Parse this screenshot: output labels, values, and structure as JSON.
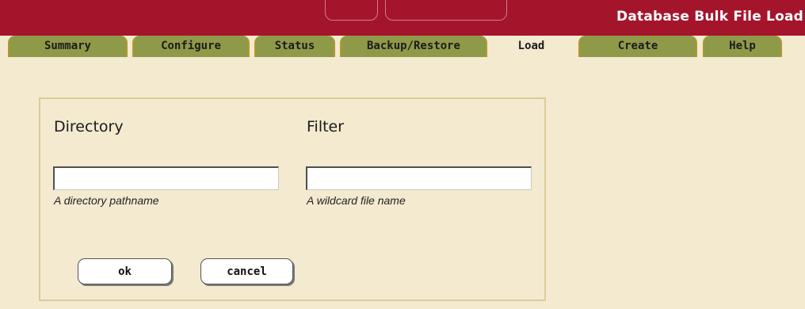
{
  "header": {
    "title": "Database Bulk File Load"
  },
  "tabs": [
    {
      "label": "Summary",
      "active": false
    },
    {
      "label": "Configure",
      "active": false
    },
    {
      "label": "Status",
      "active": false
    },
    {
      "label": "Backup/Restore",
      "active": false
    },
    {
      "label": "Load",
      "active": true
    },
    {
      "label": "Create",
      "active": false
    },
    {
      "label": "Help",
      "active": false
    }
  ],
  "form": {
    "directory": {
      "heading": "Directory",
      "value": "",
      "hint": "A directory pathname"
    },
    "filter": {
      "heading": "Filter",
      "value": "",
      "hint": "A wildcard file name"
    },
    "ok_label": "ok",
    "cancel_label": "cancel"
  },
  "colors": {
    "header_bg": "#a4152c",
    "tab_bg": "#8f9a49",
    "page_bg": "#f3ead0",
    "panel_border": "#dccc97"
  }
}
